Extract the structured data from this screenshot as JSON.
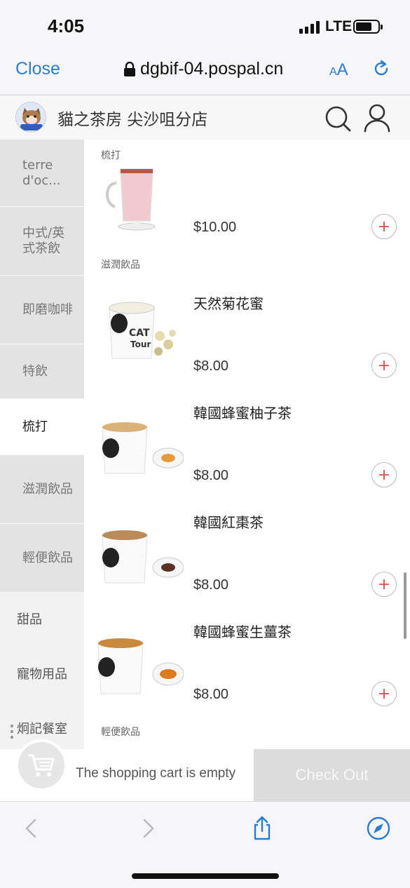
{
  "status_bar": {
    "time": "4:05",
    "network": "LTE"
  },
  "browser": {
    "close_label": "Close",
    "url": "dgbif-04.pospal.cn",
    "text_size_label": "AA"
  },
  "header": {
    "store_name": "貓之茶房 尖沙咀分店"
  },
  "sidebar": {
    "items": [
      {
        "label": "terre d'oc..."
      },
      {
        "label": "中式/英式茶飲"
      },
      {
        "label": "即磨咖啡"
      },
      {
        "label": "特飲"
      },
      {
        "label": "梳打"
      },
      {
        "label": "滋潤飲品"
      },
      {
        "label": "輕便飲品"
      },
      {
        "label": "甜品"
      },
      {
        "label": "寵物用品"
      },
      {
        "label": "炯記餐室"
      }
    ],
    "active_index": 4
  },
  "content": {
    "sections": [
      {
        "label": "梳打"
      },
      {
        "label": "滋潤飲品"
      },
      {
        "label": "輕便飲品"
      }
    ],
    "products": [
      {
        "name": "",
        "price": "$10.00",
        "image": "pink-soda-glass"
      },
      {
        "name": "天然菊花蜜",
        "price": "$8.00",
        "image": "cat-tour-mug-chrysanthemum"
      },
      {
        "name": "韓國蜂蜜柚子茶",
        "price": "$8.00",
        "image": "cat-mug-honey-citron"
      },
      {
        "name": "韓國紅棗茶",
        "price": "$8.00",
        "image": "cat-mug-red-date"
      },
      {
        "name": "韓國蜂蜜生薑茶",
        "price": "$8.00",
        "image": "cat-mug-honey-ginger"
      }
    ]
  },
  "cart": {
    "empty_text": "The shopping cart is empty",
    "checkout_label": "Check Out"
  },
  "colors": {
    "link_blue": "#2a7bd3",
    "add_plus_red": "#e24b4b",
    "active_category_bg": "#ffffff",
    "checkout_disabled_bg": "#dcdcdc"
  }
}
